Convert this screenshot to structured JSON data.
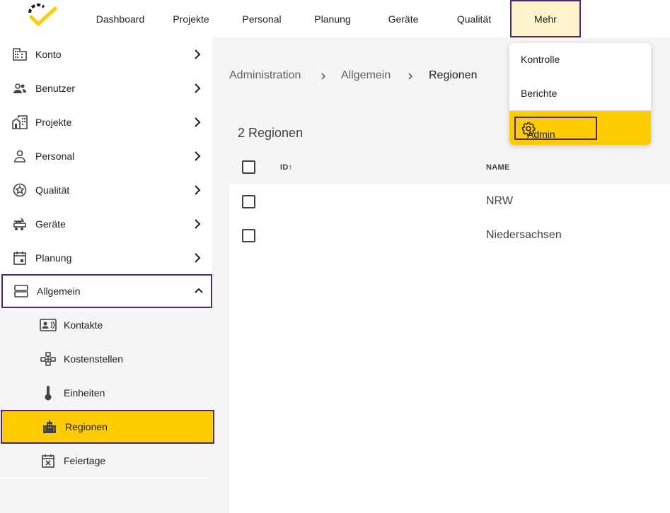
{
  "colors": {
    "accent": "#ffcc00",
    "highlight_border": "#4a2b7a",
    "active_nav_bg": "#fff3cc"
  },
  "logo": {
    "icon": "check-logo-icon"
  },
  "topnav": {
    "items": [
      {
        "label": "Dashboard"
      },
      {
        "label": "Projekte"
      },
      {
        "label": "Personal"
      },
      {
        "label": "Planung"
      },
      {
        "label": "Geräte"
      },
      {
        "label": "Qualität"
      },
      {
        "label": "Mehr",
        "active": true
      }
    ]
  },
  "more_menu": {
    "items": [
      {
        "label": "Kontrolle"
      },
      {
        "label": "Berichte"
      },
      {
        "label": "Admin",
        "icon": "gear-icon",
        "selected": true
      }
    ]
  },
  "sidebar": {
    "items": [
      {
        "label": "Konto",
        "icon": "building-icon"
      },
      {
        "label": "Benutzer",
        "icon": "users-icon"
      },
      {
        "label": "Projekte",
        "icon": "projects-icon"
      },
      {
        "label": "Personal",
        "icon": "person-icon"
      },
      {
        "label": "Qualität",
        "icon": "quality-star-icon"
      },
      {
        "label": "Geräte",
        "icon": "equipment-icon"
      },
      {
        "label": "Planung",
        "icon": "calendar-icon"
      },
      {
        "label": "Allgemein",
        "icon": "storage-icon",
        "expanded": true
      }
    ],
    "sub_items": [
      {
        "label": "Kontakte",
        "icon": "contact-card-icon"
      },
      {
        "label": "Kostenstellen",
        "icon": "hierarchy-icon"
      },
      {
        "label": "Einheiten",
        "icon": "thermometer-icon"
      },
      {
        "label": "Regionen",
        "icon": "city-icon",
        "selected": true
      },
      {
        "label": "Feiertage",
        "icon": "calendar-x-icon"
      }
    ]
  },
  "breadcrumb": {
    "items": [
      "Administration",
      "Allgemein",
      "Regionen"
    ]
  },
  "table": {
    "title": "2 Regionen",
    "columns": [
      {
        "label": "ID",
        "sort": "ascending"
      },
      {
        "label": "NAME"
      }
    ],
    "rows": [
      {
        "id": "",
        "name": "NRW"
      },
      {
        "id": "",
        "name": "Niedersachsen"
      }
    ]
  }
}
